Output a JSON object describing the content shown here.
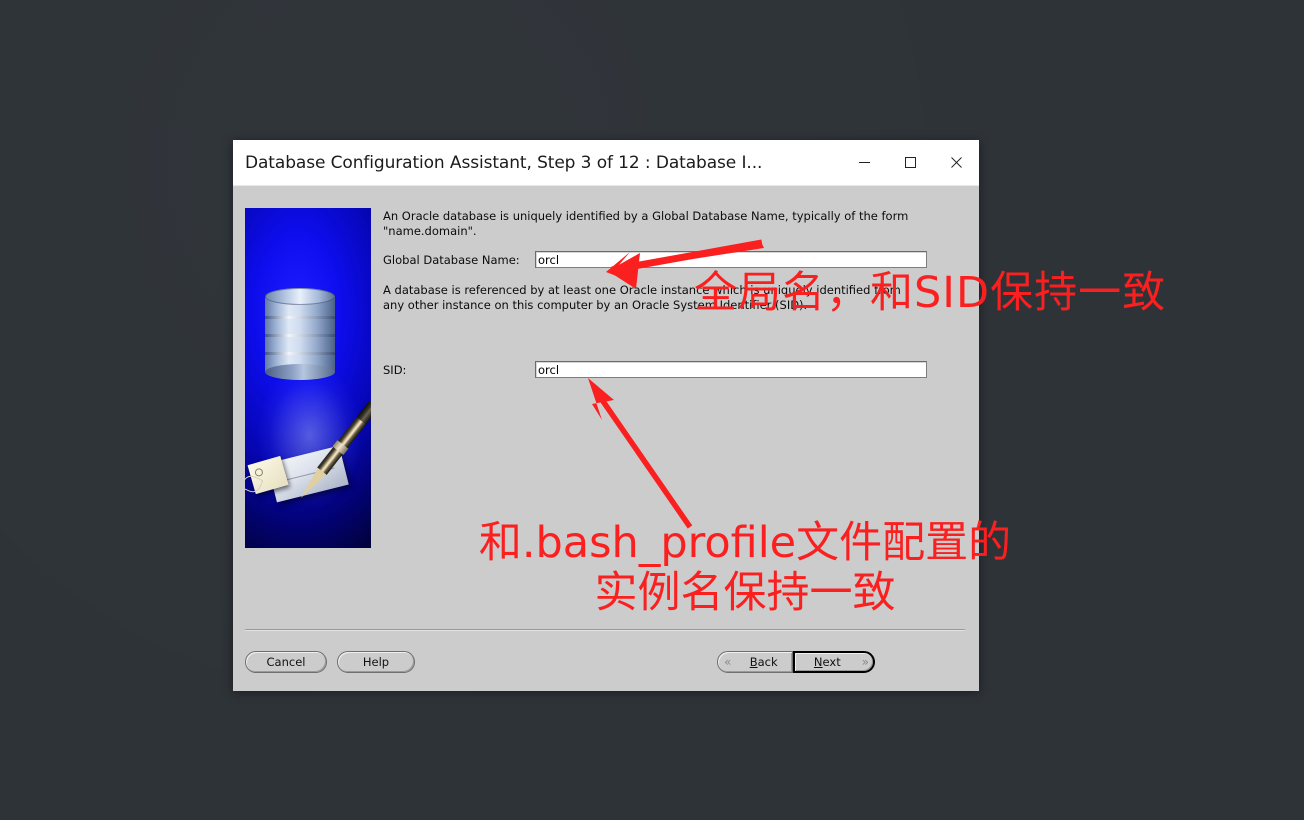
{
  "window": {
    "title": "Database Configuration Assistant, Step 3 of 12 : Database I...",
    "controls": {
      "minimize": "minimize-icon",
      "maximize": "maximize-icon",
      "close": "close-icon"
    }
  },
  "content": {
    "paragraph1": "An Oracle database is uniquely identified by a Global Database Name, typically of the form \"name.domain\".",
    "paragraph2": "A database is referenced by at least one Oracle instance which is uniquely identified from any other instance on this computer by an Oracle System Identifier (SID).",
    "fields": {
      "global_db_name": {
        "label": "Global Database Name:",
        "value": "orcl"
      },
      "sid": {
        "label": "SID:",
        "value": "orcl"
      }
    }
  },
  "footer": {
    "cancel": "Cancel",
    "help": "Help",
    "back": "Back",
    "back_underline": "B",
    "back_rest": "ack",
    "next": "Next",
    "next_underline": "N",
    "next_rest": "ext",
    "back_chevron": "«",
    "next_chevron": "»"
  },
  "annotations": {
    "top_note": "全局名，和SID保持一致",
    "bottom_note": "和.bash_profile文件配置的\n实例名保持一致",
    "color": "#fa2020",
    "arrow_top": "arrow-pointing-to-global-db-name-field",
    "arrow_bottom": "arrow-pointing-to-sid-field"
  },
  "theme": {
    "desktop_bg": "#2e3338",
    "window_bg": "#cccccc",
    "titlebar_bg": "#ffffff",
    "graphic_bg": "#0d0dee"
  }
}
